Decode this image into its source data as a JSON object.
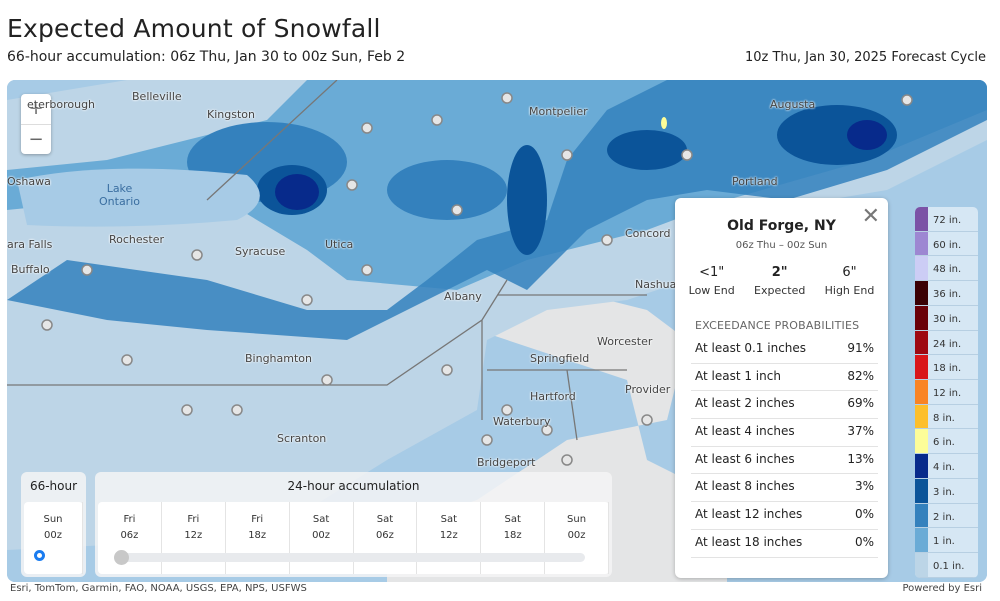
{
  "header": {
    "title": "Expected Amount of Snowfall",
    "subtitle": "66-hour accumulation:  06z Thu, Jan 30  to  00z Sun, Feb 2",
    "forecast_cycle": "10z Thu, Jan 30, 2025 Forecast Cycle"
  },
  "map": {
    "zoom_in": "+",
    "zoom_out": "−",
    "labels": [
      {
        "text": "eterborough",
        "pos": [
          20,
          18
        ]
      },
      {
        "text": "Belleville",
        "pos": [
          125,
          10
        ]
      },
      {
        "text": "Kingston",
        "pos": [
          200,
          28
        ]
      },
      {
        "text": "Oshawa",
        "pos": [
          0,
          95
        ]
      },
      {
        "text": "Rochester",
        "pos": [
          102,
          153
        ]
      },
      {
        "text": "Syracuse",
        "pos": [
          228,
          165
        ]
      },
      {
        "text": "Utica",
        "pos": [
          318,
          158
        ]
      },
      {
        "text": "ara Falls",
        "pos": [
          0,
          158
        ]
      },
      {
        "text": "Buffalo",
        "pos": [
          4,
          183
        ]
      },
      {
        "text": "Binghamton",
        "pos": [
          238,
          272
        ]
      },
      {
        "text": "Scranton",
        "pos": [
          270,
          352
        ]
      },
      {
        "text": "Albany",
        "pos": [
          437,
          210
        ]
      },
      {
        "text": "Montpelier",
        "pos": [
          522,
          25
        ]
      },
      {
        "text": "Augusta",
        "pos": [
          763,
          18
        ]
      },
      {
        "text": "Portland",
        "pos": [
          725,
          95
        ]
      },
      {
        "text": "Concord",
        "pos": [
          618,
          147
        ]
      },
      {
        "text": "Nashua",
        "pos": [
          628,
          198
        ]
      },
      {
        "text": "Worcester",
        "pos": [
          590,
          255
        ]
      },
      {
        "text": "Springfield",
        "pos": [
          523,
          272
        ]
      },
      {
        "text": "Hartford",
        "pos": [
          523,
          310
        ]
      },
      {
        "text": "Provider",
        "pos": [
          618,
          303
        ]
      },
      {
        "text": "Waterbury",
        "pos": [
          486,
          335
        ]
      },
      {
        "text": "Bridgeport",
        "pos": [
          470,
          376
        ]
      }
    ],
    "lake_label": "Lake\nOntario"
  },
  "popup": {
    "location": "Old Forge, NY",
    "range": "06z Thu  –  00z Sun",
    "low": {
      "value": "<1\"",
      "label": "Low End"
    },
    "expected": {
      "value": "2\"",
      "label": "Expected"
    },
    "high": {
      "value": "6\"",
      "label": "High End"
    },
    "exceedance_heading": "EXCEEDANCE PROBABILITIES",
    "rows": [
      {
        "label": "At least 0.1 inches",
        "value": "91%"
      },
      {
        "label": "At least 1 inch",
        "value": "82%"
      },
      {
        "label": "At least 2 inches",
        "value": "69%"
      },
      {
        "label": "At least 4 inches",
        "value": "37%"
      },
      {
        "label": "At least 6 inches",
        "value": "13%"
      },
      {
        "label": "At least 8 inches",
        "value": "3%"
      },
      {
        "label": "At least 12 inches",
        "value": "0%"
      },
      {
        "label": "At least 18 inches",
        "value": "0%"
      }
    ],
    "close_icon": "close-icon"
  },
  "legend": [
    {
      "label": "72 in.",
      "color": "#7b52a6"
    },
    {
      "label": "60 in.",
      "color": "#9d87d2"
    },
    {
      "label": "48 in.",
      "color": "#cccdf5"
    },
    {
      "label": "36 in.",
      "color": "#3a0004"
    },
    {
      "label": "30 in.",
      "color": "#6a0008"
    },
    {
      "label": "24 in.",
      "color": "#9e0811"
    },
    {
      "label": "18 in.",
      "color": "#d9161a"
    },
    {
      "label": "12 in.",
      "color": "#f98424"
    },
    {
      "label": "8 in.",
      "color": "#fdbf2b"
    },
    {
      "label": "6 in.",
      "color": "#fdfd99"
    },
    {
      "label": "4 in.",
      "color": "#072a8b"
    },
    {
      "label": "3 in.",
      "color": "#0b5499"
    },
    {
      "label": "2 in.",
      "color": "#3481bd"
    },
    {
      "label": "1 in.",
      "color": "#6aabd6"
    },
    {
      "label": "0.1 in.",
      "color": "#bcd5e7"
    }
  ],
  "timeline": {
    "total": {
      "heading": "66-hour",
      "day": "Sun",
      "hour": "00z",
      "selected": true
    },
    "daily": {
      "heading": "24-hour accumulation",
      "steps": [
        {
          "day": "Fri",
          "hour": "06z"
        },
        {
          "day": "Fri",
          "hour": "12z"
        },
        {
          "day": "Fri",
          "hour": "18z"
        },
        {
          "day": "Sat",
          "hour": "00z"
        },
        {
          "day": "Sat",
          "hour": "06z"
        },
        {
          "day": "Sat",
          "hour": "12z"
        },
        {
          "day": "Sat",
          "hour": "18z"
        },
        {
          "day": "Sun",
          "hour": "00z"
        }
      ],
      "slider_position": 0
    }
  },
  "attribution": {
    "left": "Esri, TomTom, Garmin, FAO, NOAA, USGS, EPA, NPS, USFWS",
    "right": "Powered by Esri"
  }
}
